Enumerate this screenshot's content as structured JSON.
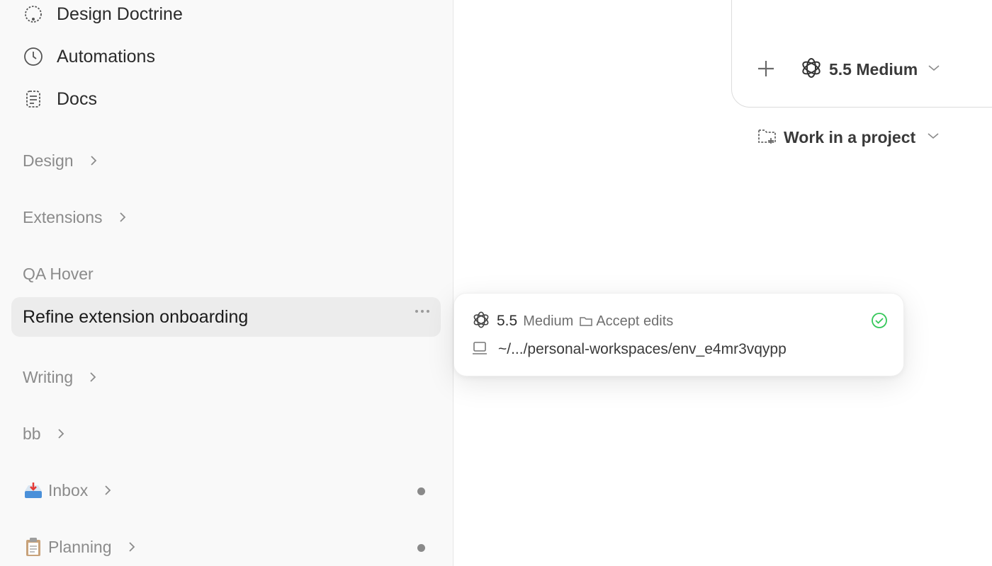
{
  "sidebar": {
    "nav": [
      {
        "label": "Design Doctrine",
        "icon": "palette-icon"
      },
      {
        "label": "Automations",
        "icon": "clock-icon"
      },
      {
        "label": "Docs",
        "icon": "document-icon"
      }
    ],
    "groups": {
      "design": "Design",
      "extensions": "Extensions",
      "qa_hover": "QA Hover",
      "writing": "Writing",
      "bb": "bb",
      "inbox": "Inbox",
      "planning": "Planning"
    },
    "active_thread": "Refine extension onboarding"
  },
  "composer": {
    "model": "5.5 Medium",
    "project": "Work in a project"
  },
  "popover": {
    "version": "5.5",
    "effort": "Medium",
    "mode": "Accept edits",
    "path": "~/.../personal-workspaces/env_e4mr3vqypp"
  },
  "colors": {
    "sidebar_bg": "#f9f9f9",
    "active_bg": "#ececec",
    "success": "#34c759"
  }
}
